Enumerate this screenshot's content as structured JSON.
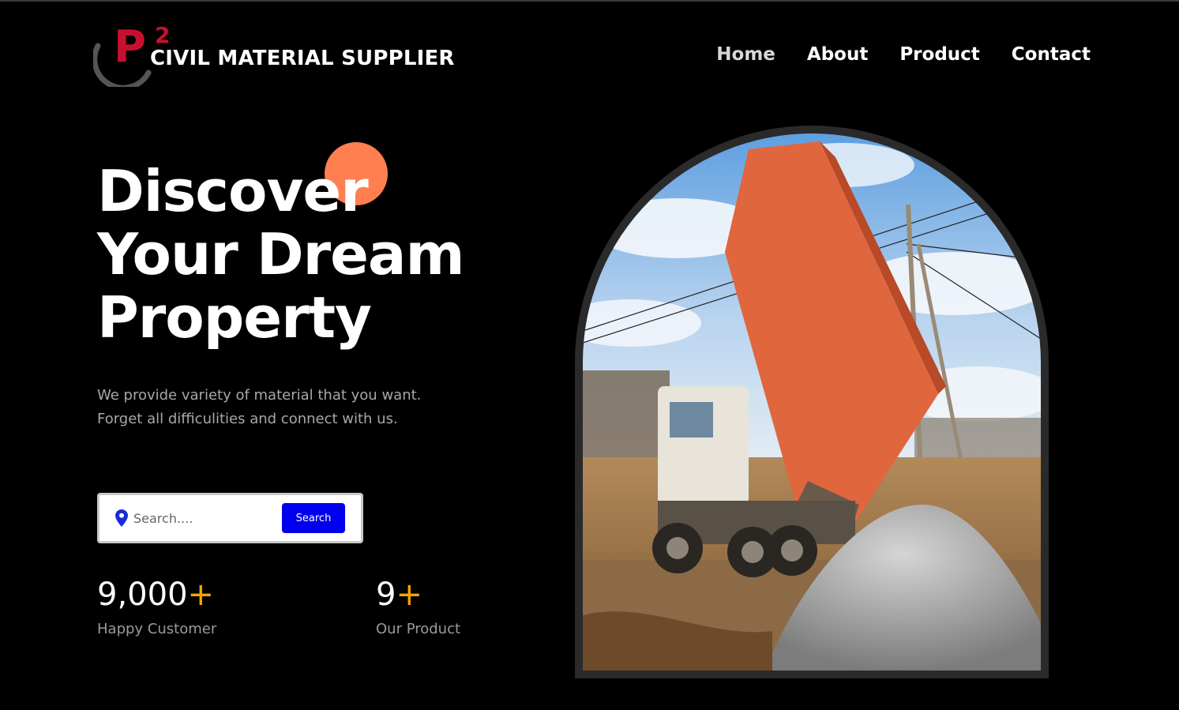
{
  "header": {
    "logo": {
      "mark_letter": "P",
      "mark_superscript": "2",
      "brand_text": "CIVIL MATERIAL SUPPLIER"
    },
    "nav": [
      {
        "label": "Home",
        "active": true
      },
      {
        "label": "About",
        "active": false
      },
      {
        "label": "Product",
        "active": false
      },
      {
        "label": "Contact",
        "active": false
      }
    ]
  },
  "hero": {
    "title_lines": [
      "Discover",
      "Your Dream",
      "Property"
    ],
    "subtitle_lines": [
      "We provide variety of material that you want.",
      "Forget all difficulities and connect with us."
    ],
    "search": {
      "placeholder": "Search....",
      "button_label": "Search",
      "icon": "location-pin-icon"
    },
    "stats": [
      {
        "value": "9,000",
        "suffix": "+",
        "label": "Happy Customer"
      },
      {
        "value": "9",
        "suffix": "+",
        "label": "Our Product"
      }
    ]
  },
  "image": {
    "subject": "dump-truck-unloading-gravel",
    "icon": "photo"
  },
  "colors": {
    "background": "#000000",
    "accent_orange": "#ff7f50",
    "brand_red": "#c8102e",
    "button_blue": "#0000ee",
    "plus_yellow": "#ffa500"
  }
}
